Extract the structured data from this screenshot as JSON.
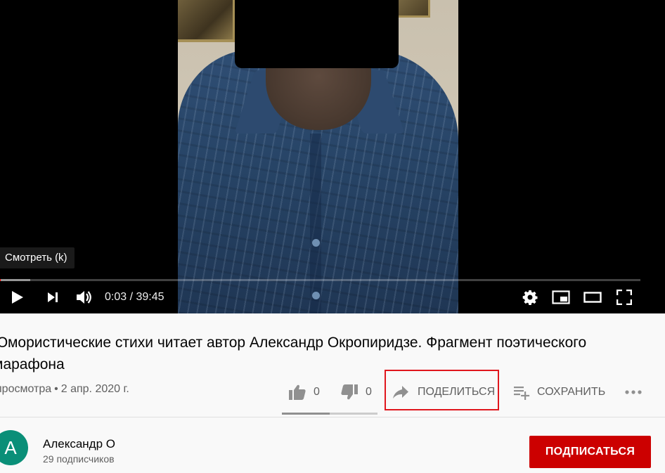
{
  "player": {
    "tooltip": "Смотреть (k)",
    "time_current": "0:03",
    "time_separator": " / ",
    "time_total": "39:45",
    "progress_played_fraction": 0.0013,
    "progress_loaded_fraction": 0.047,
    "controls": {
      "play": "play-icon",
      "next": "next-icon",
      "volume": "volume-icon",
      "settings": "gear-icon",
      "miniplayer": "miniplayer-icon",
      "theater": "theater-icon",
      "fullscreen": "fullscreen-icon"
    }
  },
  "video": {
    "title": "Юмористические стихи читает автор Александр Окропиридзе. Фрагмент поэтического марафона",
    "views": "просмотра",
    "date": "2 апр. 2020 г.",
    "meta_separator": "•"
  },
  "actions": {
    "like_count": "0",
    "dislike_count": "0",
    "share_label": "Поделиться",
    "save_label": "Сохранить",
    "sentiment_like_fraction": 0.5
  },
  "channel": {
    "avatar_letter": "А",
    "name": "Александр О",
    "subscribers": "29 подписчиков",
    "subscribe_label": "ПОДПИСАТЬСЯ"
  },
  "colors": {
    "accent": "#ff0000",
    "subscribe_bg": "#cc0000",
    "highlight_border": "#e0161d",
    "avatar_bg": "#0a8f78"
  }
}
